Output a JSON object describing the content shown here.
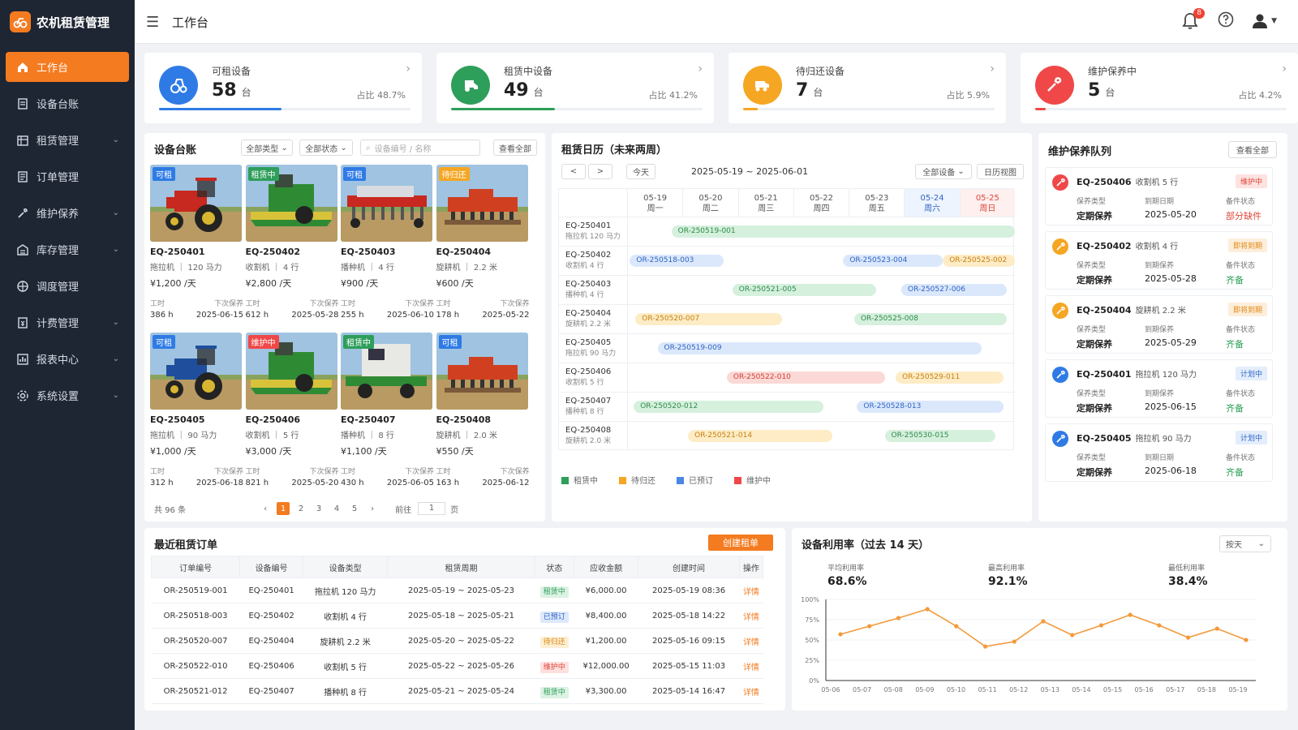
{
  "app": {
    "title": "农机租赁管理"
  },
  "topbar": {
    "page_title": "工作台",
    "bell_count": "8"
  },
  "sidebar": {
    "items": [
      {
        "label": "工作台",
        "icon": "home-icon",
        "active": true,
        "arrow": false
      },
      {
        "label": "设备台账",
        "icon": "ledger-icon",
        "arrow": false
      },
      {
        "label": "租赁管理",
        "icon": "lease-icon",
        "arrow": true
      },
      {
        "label": "订单管理",
        "icon": "order-icon",
        "arrow": false
      },
      {
        "label": "维护保养",
        "icon": "wrench-icon",
        "arrow": true
      },
      {
        "label": "库存管理",
        "icon": "warehouse-icon",
        "arrow": true
      },
      {
        "label": "调度管理",
        "icon": "dispatch-icon",
        "arrow": false
      },
      {
        "label": "计费管理",
        "icon": "billing-icon",
        "arrow": true
      },
      {
        "label": "报表中心",
        "icon": "report-icon",
        "arrow": true
      },
      {
        "label": "系统设置",
        "icon": "settings-icon",
        "arrow": true
      }
    ]
  },
  "stats": [
    {
      "label": "可租设备",
      "value": "58",
      "unit": "台",
      "ratio": "占比 48.7%",
      "percent": 48.7,
      "color": "#2f7be5",
      "icon": "tractor-icon"
    },
    {
      "label": "租赁中设备",
      "value": "49",
      "unit": "台",
      "ratio": "占比 41.2%",
      "percent": 41.2,
      "color": "#2e9e5b",
      "icon": "harvester-icon"
    },
    {
      "label": "待归还设备",
      "value": "7",
      "unit": "台",
      "ratio": "占比 5.9%",
      "percent": 5.9,
      "color": "#f5a623",
      "icon": "return-icon"
    },
    {
      "label": "维护保养中",
      "value": "5",
      "unit": "台",
      "ratio": "占比 4.2%",
      "percent": 4.2,
      "color": "#f04848",
      "icon": "wrench-icon"
    }
  ],
  "ledger": {
    "title": "设备台账",
    "filter_type": "全部类型",
    "filter_status": "全部状态",
    "search_placeholder": "设备编号 / 名称",
    "view_all": "查看全部",
    "hours_label": "工时",
    "next_label": "下次保养",
    "items": [
      {
        "tag": "可租",
        "tag_color": "#2f7be5",
        "id": "EQ-250401",
        "spec": "拖拉机 ｜ 120 马力",
        "price": "¥1,200 /天",
        "hours": "386 h",
        "next": "2025-06-15",
        "img": "red-tractor"
      },
      {
        "tag": "租赁中",
        "tag_color": "#2e9e5b",
        "id": "EQ-250402",
        "spec": "收割机 ｜ 4 行",
        "price": "¥2,800 /天",
        "hours": "612 h",
        "next": "2025-05-28",
        "img": "green-harvester"
      },
      {
        "tag": "可租",
        "tag_color": "#2f7be5",
        "id": "EQ-250403",
        "spec": "播种机 ｜ 4 行",
        "price": "¥900 /天",
        "hours": "255 h",
        "next": "2025-06-10",
        "img": "red-seeder"
      },
      {
        "tag": "待归还",
        "tag_color": "#f5a623",
        "id": "EQ-250404",
        "spec": "旋耕机 ｜ 2.2 米",
        "price": "¥600 /天",
        "hours": "178 h",
        "next": "2025-05-22",
        "img": "red-tiller"
      },
      {
        "tag": "可租",
        "tag_color": "#2f7be5",
        "id": "EQ-250405",
        "spec": "拖拉机 ｜ 90 马力",
        "price": "¥1,000 /天",
        "hours": "312 h",
        "next": "2025-06-18",
        "img": "blue-tractor"
      },
      {
        "tag": "维护中",
        "tag_color": "#f04848",
        "id": "EQ-250406",
        "spec": "收割机 ｜ 5 行",
        "price": "¥3,000 /天",
        "hours": "821 h",
        "next": "2025-05-20",
        "img": "green-harvester"
      },
      {
        "tag": "租赁中",
        "tag_color": "#2e9e5b",
        "id": "EQ-250407",
        "spec": "播种机 ｜ 8 行",
        "price": "¥1,100 /天",
        "hours": "430 h",
        "next": "2025-06-05",
        "img": "white-seeder"
      },
      {
        "tag": "可租",
        "tag_color": "#2f7be5",
        "id": "EQ-250408",
        "spec": "旋耕机 ｜ 2.0 米",
        "price": "¥550 /天",
        "hours": "163 h",
        "next": "2025-06-12",
        "img": "red-tiller"
      }
    ],
    "total": "共 96 条",
    "pages": [
      "1",
      "2",
      "3",
      "4",
      "5"
    ],
    "goto": "前往",
    "goto_value": "1",
    "page_unit": "页"
  },
  "calendar": {
    "title": "租赁日历（未来两周）",
    "today": "今天",
    "range": "2025-05-19 ~ 2025-06-01",
    "filter": "全部设备",
    "view": "日历视图",
    "days": [
      {
        "date": "05-19",
        "week": "周一",
        "kind": "normal"
      },
      {
        "date": "05-20",
        "week": "周二",
        "kind": "normal"
      },
      {
        "date": "05-21",
        "week": "周三",
        "kind": "normal"
      },
      {
        "date": "05-22",
        "week": "周四",
        "kind": "normal"
      },
      {
        "date": "05-23",
        "week": "周五",
        "kind": "normal"
      },
      {
        "date": "05-24",
        "week": "周六",
        "kind": "sat"
      },
      {
        "date": "05-25",
        "week": "周日",
        "kind": "sun"
      }
    ],
    "rows": [
      {
        "id": "EQ-250401",
        "spec": "拖拉机 120 马力",
        "bars": [
          {
            "label": "OR-250519-001",
            "c": "green",
            "s": 0.8,
            "e": 7.0
          }
        ]
      },
      {
        "id": "EQ-250402",
        "spec": "收割机 4 行",
        "bars": [
          {
            "label": "OR-250518-003",
            "c": "blue",
            "s": 0.05,
            "e": 1.75
          },
          {
            "label": "OR-250523-004",
            "c": "blue",
            "s": 3.9,
            "e": 5.7
          },
          {
            "label": "OR-250525-002",
            "c": "yellow",
            "s": 5.7,
            "e": 7.0
          }
        ]
      },
      {
        "id": "EQ-250403",
        "spec": "播种机 4 行",
        "bars": [
          {
            "label": "OR-250521-005",
            "c": "green",
            "s": 1.9,
            "e": 4.5
          },
          {
            "label": "OR-250527-006",
            "c": "blue",
            "s": 4.95,
            "e": 6.85
          }
        ]
      },
      {
        "id": "EQ-250404",
        "spec": "旋耕机 2.2 米",
        "bars": [
          {
            "label": "OR-250520-007",
            "c": "yellow",
            "s": 0.15,
            "e": 2.8
          },
          {
            "label": "OR-250525-008",
            "c": "green",
            "s": 4.1,
            "e": 6.85
          }
        ]
      },
      {
        "id": "EQ-250405",
        "spec": "拖拉机 90 马力",
        "bars": [
          {
            "label": "OR-250519-009",
            "c": "blue",
            "s": 0.55,
            "e": 6.4
          }
        ]
      },
      {
        "id": "EQ-250406",
        "spec": "收割机 5 行",
        "bars": [
          {
            "label": "OR-250522-010",
            "c": "red",
            "s": 1.8,
            "e": 4.65
          },
          {
            "label": "OR-250529-011",
            "c": "yellow",
            "s": 4.85,
            "e": 6.8
          }
        ]
      },
      {
        "id": "EQ-250407",
        "spec": "播种机 8 行",
        "bars": [
          {
            "label": "OR-250520-012",
            "c": "green",
            "s": 0.12,
            "e": 3.55
          },
          {
            "label": "OR-250528-013",
            "c": "blue",
            "s": 4.15,
            "e": 6.8
          }
        ]
      },
      {
        "id": "EQ-250408",
        "spec": "旋耕机 2.0 米",
        "bars": [
          {
            "label": "OR-250521-014",
            "c": "yellow",
            "s": 1.1,
            "e": 3.7
          },
          {
            "label": "OR-250530-015",
            "c": "green",
            "s": 4.65,
            "e": 6.65
          }
        ]
      }
    ],
    "legend": [
      {
        "label": "租赁中",
        "color": "#2e9e5b"
      },
      {
        "label": "待归还",
        "color": "#f5a623"
      },
      {
        "label": "已预订",
        "color": "#4a86e8"
      },
      {
        "label": "维护中",
        "color": "#f04848"
      }
    ]
  },
  "maintenance": {
    "title": "维护保养队列",
    "view_all": "查看全部",
    "col1": "保养类型",
    "col3": "备件状态",
    "items": [
      {
        "id": "EQ-250406",
        "spec": "收割机 5 行",
        "badge": "维护中",
        "badge_bg": "#fde2e0",
        "badge_fg": "#e0463a",
        "icon_bg": "#f04848",
        "col2": "到期日期",
        "type": "定期保养",
        "date": "2025-05-20",
        "parts": "部分缺件",
        "parts_color": "#e0463a"
      },
      {
        "id": "EQ-250402",
        "spec": "收割机 4 行",
        "badge": "即将到期",
        "badge_bg": "#fdeedb",
        "badge_fg": "#e08a12",
        "icon_bg": "#f5a623",
        "col2": "到期保养",
        "type": "定期保养",
        "date": "2025-05-28",
        "parts": "齐备",
        "parts_color": "#2e9e5b"
      },
      {
        "id": "EQ-250404",
        "spec": "旋耕机 2.2 米",
        "badge": "即将到期",
        "badge_bg": "#fdeedb",
        "badge_fg": "#e08a12",
        "icon_bg": "#f5a623",
        "col2": "到期保养",
        "type": "定期保养",
        "date": "2025-05-29",
        "parts": "齐备",
        "parts_color": "#2e9e5b"
      },
      {
        "id": "EQ-250401",
        "spec": "拖拉机 120 马力",
        "badge": "计划中",
        "badge_bg": "#e3edfc",
        "badge_fg": "#2f64c4",
        "icon_bg": "#2f7be5",
        "col2": "到期保养",
        "type": "定期保养",
        "date": "2025-06-15",
        "parts": "齐备",
        "parts_color": "#2e9e5b"
      },
      {
        "id": "EQ-250405",
        "spec": "拖拉机 90 马力",
        "badge": "计划中",
        "badge_bg": "#e3edfc",
        "badge_fg": "#2f64c4",
        "icon_bg": "#2f7be5",
        "col2": "到期日期",
        "type": "定期保养",
        "date": "2025-06-18",
        "parts": "齐备",
        "parts_color": "#2e9e5b"
      }
    ]
  },
  "orders": {
    "title": "最近租赁订单",
    "create": "创建租单",
    "columns": [
      "订单编号",
      "设备编号",
      "设备类型",
      "租赁周期",
      "状态",
      "应收金额",
      "创建时间",
      "操作"
    ],
    "rows": [
      {
        "no": "OR-250519-001",
        "eq": "EQ-250401",
        "type": "拖拉机 120 马力",
        "period": "2025-05-19 ~ 2025-05-23",
        "status": "租赁中",
        "sbg": "#dcf2e3",
        "sfg": "#2e9e5b",
        "amount": "¥6,000.00",
        "time": "2025-05-19 08:36",
        "op": "详情"
      },
      {
        "no": "OR-250518-003",
        "eq": "EQ-250402",
        "type": "收割机 4 行",
        "period": "2025-05-18 ~ 2025-05-21",
        "status": "已预订",
        "sbg": "#dde9fb",
        "sfg": "#2f64c4",
        "amount": "¥8,400.00",
        "time": "2025-05-18 14:22",
        "op": "详情"
      },
      {
        "no": "OR-250520-007",
        "eq": "EQ-250404",
        "type": "旋耕机 2.2 米",
        "period": "2025-05-20 ~ 2025-05-22",
        "status": "待归还",
        "sbg": "#fdefd3",
        "sfg": "#d88a14",
        "amount": "¥1,200.00",
        "time": "2025-05-16 09:15",
        "op": "详情"
      },
      {
        "no": "OR-250522-010",
        "eq": "EQ-250406",
        "type": "收割机 5 行",
        "period": "2025-05-22 ~ 2025-05-26",
        "status": "维护中",
        "sbg": "#fde0de",
        "sfg": "#e0463a",
        "amount": "¥12,000.00",
        "time": "2025-05-15 11:03",
        "op": "详情"
      },
      {
        "no": "OR-250521-012",
        "eq": "EQ-250407",
        "type": "播种机 8 行",
        "period": "2025-05-21 ~ 2025-05-24",
        "status": "租赁中",
        "sbg": "#dcf2e3",
        "sfg": "#2e9e5b",
        "amount": "¥3,300.00",
        "time": "2025-05-14 16:47",
        "op": "详情"
      }
    ]
  },
  "utilization": {
    "title": "设备利用率（过去 14 天）",
    "select": "按天",
    "kpis": [
      {
        "label": "平均利用率",
        "value": "68.6%"
      },
      {
        "label": "最高利用率",
        "value": "92.1%"
      },
      {
        "label": "最低利用率",
        "value": "38.4%"
      }
    ]
  },
  "chart_data": {
    "type": "line",
    "title": "",
    "xlabel": "",
    "ylabel": "",
    "x": [
      "05-06",
      "05-07",
      "05-08",
      "05-09",
      "05-10",
      "05-11",
      "05-12",
      "05-13",
      "05-14",
      "05-15",
      "05-16",
      "05-17",
      "05-18",
      "05-19"
    ],
    "series": [
      {
        "values": [
          57,
          67,
          77,
          88,
          67,
          42,
          48,
          73,
          56,
          68,
          81,
          68,
          53,
          64,
          50
        ]
      }
    ],
    "y_ticks": [
      "0%",
      "25%",
      "50%",
      "75%",
      "100%"
    ],
    "ylim": [
      0,
      100
    ],
    "color": "#f39a3a",
    "grid": true
  }
}
